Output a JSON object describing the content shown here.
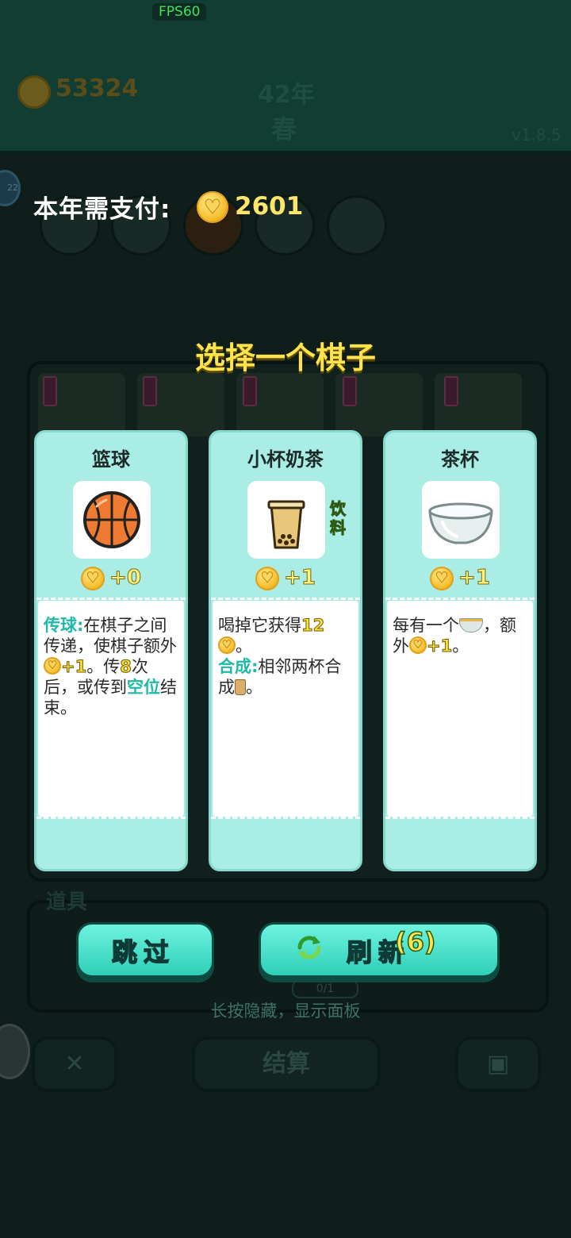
{
  "debug": {
    "fps": "FPS60"
  },
  "header": {
    "money": "53324",
    "year": "42年",
    "season": "春",
    "version": "v1.8.5"
  },
  "payment": {
    "label": "本年需支付:",
    "amount": "2601"
  },
  "side_badge": "22",
  "choose": {
    "title": "选择一个棋子",
    "cards": [
      {
        "name": "篮球",
        "price": "+0",
        "desc": {
          "kw1": "传球:",
          "t1": "在棋子之间传递，使棋子额外",
          "num1": "+1",
          "t2": "。传",
          "num2": "8",
          "t3": "次后，或传到",
          "kw2": "空位",
          "t4": "结束。"
        }
      },
      {
        "name": "小杯奶茶",
        "price": "+1",
        "tag": "饮料",
        "desc": {
          "t1": "喝掉它获得",
          "num1": "12",
          "t2": "。",
          "kw1": "合成:",
          "t3": "相邻两杯合成",
          "t4": "。"
        }
      },
      {
        "name": "茶杯",
        "price": "+1",
        "desc": {
          "t1": "每有一个",
          "t2": "，额外",
          "num1": "+1",
          "t3": "。"
        }
      }
    ]
  },
  "tools": {
    "label": "道具",
    "counter": "0/1",
    "hint": "长按隐藏，显示面板"
  },
  "actions": {
    "skip": "跳过",
    "refresh": "刷新",
    "refresh_count": "(6)",
    "settle": "结算"
  },
  "colors": {
    "card_bg": "#a9ede5",
    "title_yellow": "#ffe34d",
    "keyword": "#1fb9a8",
    "button": "#2fcfb8"
  }
}
